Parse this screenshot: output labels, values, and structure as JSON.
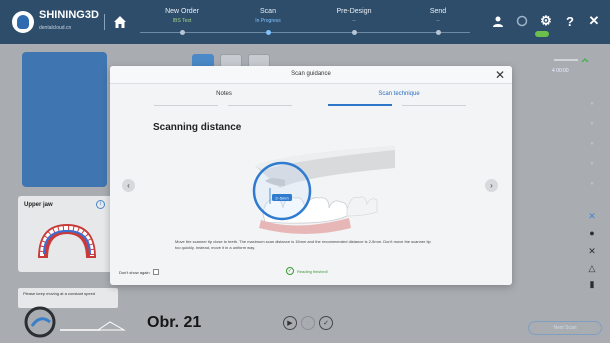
{
  "app": {
    "brand": "SHINING3D",
    "brand_sub": "dentalcloud.cn"
  },
  "steps": [
    {
      "label": "New Order",
      "sub": "IBS Test"
    },
    {
      "label": "Scan",
      "sub": "In Progress"
    },
    {
      "label": "Pre-Design",
      "sub": "--"
    },
    {
      "label": "Send",
      "sub": "--"
    }
  ],
  "toolbar_icons": [
    "user-icon",
    "status-icon",
    "gear-icon",
    "help-icon",
    "close-icon"
  ],
  "top_right_glyphs": {
    "help": "?",
    "close": "✕",
    "gear": "⚙"
  },
  "status": {
    "row2": "4  00:00"
  },
  "upper_jaw": {
    "label": "Upper jaw",
    "info": "i"
  },
  "hint": {
    "text": "Please keep moving at a constant speed"
  },
  "bottom": {
    "figure_label": "Obr. 21",
    "next_button": "Next Scan"
  },
  "modal": {
    "title": "Scan guidance",
    "close": "✕",
    "tabs": [
      {
        "label": "Notes",
        "active": false
      },
      {
        "label": "Scan technique",
        "active": true
      }
    ],
    "section_title": "Scanning distance",
    "prev": "‹",
    "next": "›",
    "distance_label": "2–5mm",
    "instruction": "Move the scanner tip close to teeth. The maximum scan distance is 15mm and the recommended distance is 2-5mm. Don't move the scanner tip too quickly. Instead, move it in a uniform way.",
    "dont_show": "Don't show again",
    "finished": "Reading finished!"
  },
  "colors": {
    "topbar": "#2e4d6b",
    "accent": "#2e76c9",
    "success": "#3a9a3a"
  }
}
